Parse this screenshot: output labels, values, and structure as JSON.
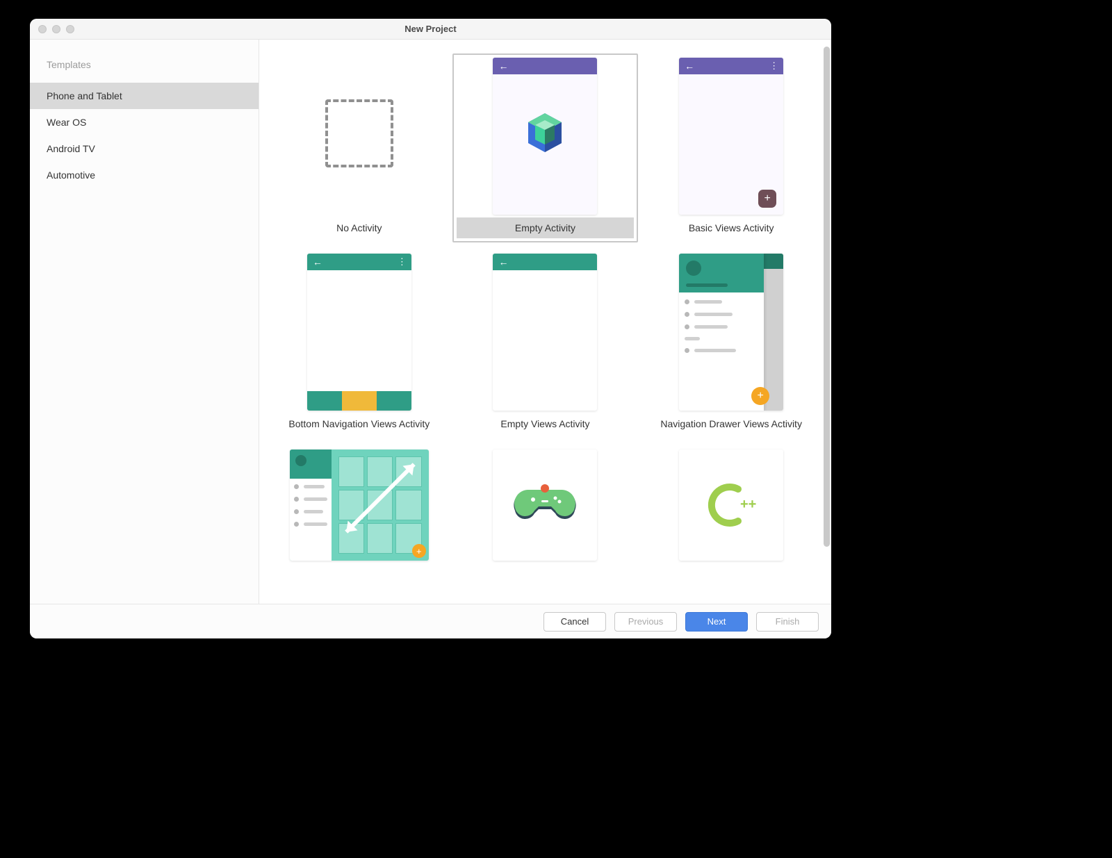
{
  "window": {
    "title": "New Project"
  },
  "sidebar": {
    "header": "Templates",
    "items": [
      {
        "label": "Phone and Tablet",
        "selected": true
      },
      {
        "label": "Wear OS",
        "selected": false
      },
      {
        "label": "Android TV",
        "selected": false
      },
      {
        "label": "Automotive",
        "selected": false
      }
    ]
  },
  "templates": [
    {
      "id": "no-activity",
      "label": "No Activity",
      "selected": false
    },
    {
      "id": "empty-activity",
      "label": "Empty Activity",
      "selected": true
    },
    {
      "id": "basic-views-activity",
      "label": "Basic Views Activity",
      "selected": false
    },
    {
      "id": "bottom-navigation-views-activity",
      "label": "Bottom Navigation Views Activity",
      "selected": false
    },
    {
      "id": "empty-views-activity",
      "label": "Empty Views Activity",
      "selected": false
    },
    {
      "id": "navigation-drawer-views-activity",
      "label": "Navigation Drawer Views Activity",
      "selected": false
    },
    {
      "id": "responsive-views-activity",
      "label": "",
      "selected": false
    },
    {
      "id": "game-activity",
      "label": "",
      "selected": false
    },
    {
      "id": "native-cpp",
      "label": "",
      "selected": false
    }
  ],
  "footer": {
    "cancel": "Cancel",
    "previous": "Previous",
    "next": "Next",
    "finish": "Finish"
  }
}
